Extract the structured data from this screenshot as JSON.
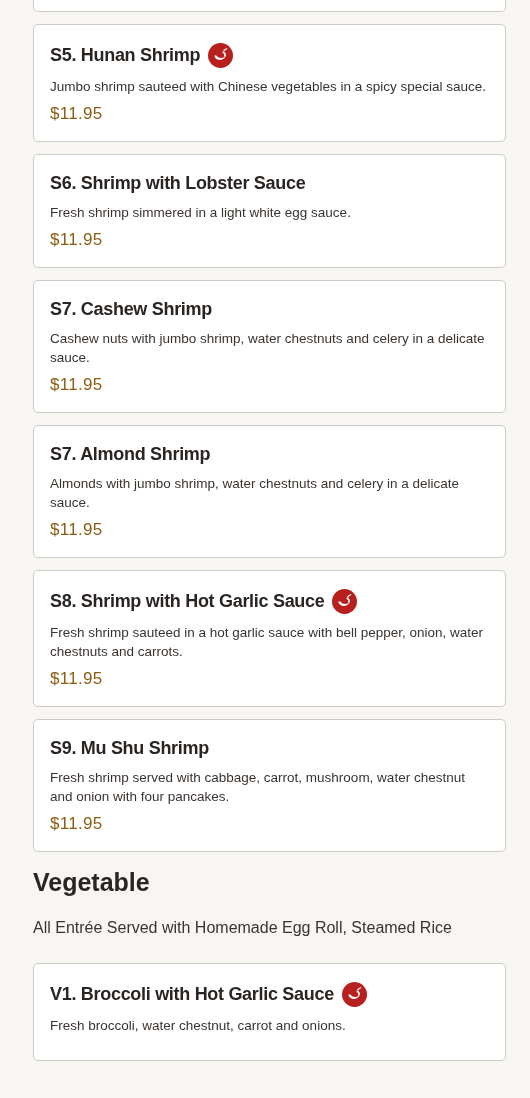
{
  "sections": [
    {
      "items": [
        {
          "name": "S5. Hunan Shrimp",
          "spicy": true,
          "description": "Jumbo shrimp sauteed with Chinese vegetables in a spicy special sauce.",
          "price": "$11.95"
        },
        {
          "name": "S6. Shrimp with Lobster Sauce",
          "spicy": false,
          "description": "Fresh shrimp simmered in a light white egg sauce.",
          "price": "$11.95"
        },
        {
          "name": "S7. Cashew Shrimp",
          "spicy": false,
          "description": "Cashew nuts with jumbo shrimp, water chestnuts and celery in a delicate sauce.",
          "price": "$11.95"
        },
        {
          "name": "S7. Almond Shrimp",
          "spicy": false,
          "description": "Almonds with jumbo shrimp, water chestnuts and celery in a delicate sauce.",
          "price": "$11.95"
        },
        {
          "name": "S8. Shrimp with Hot Garlic Sauce",
          "spicy": true,
          "description": "Fresh shrimp sauteed in a hot garlic sauce with bell pepper, onion, water chestnuts and carrots.",
          "price": "$11.95"
        },
        {
          "name": "S9. Mu Shu Shrimp",
          "spicy": false,
          "description": "Fresh shrimp served with cabbage, carrot, mushroom, water chestnut and onion with four pancakes.",
          "price": "$11.95"
        }
      ]
    },
    {
      "title": "Vegetable",
      "subtitle": "All Entrée Served with Homemade Egg Roll, Steamed Rice",
      "items": [
        {
          "name": "V1. Broccoli with Hot Garlic Sauce",
          "spicy": true,
          "description": "Fresh broccoli, water chestnut, carrot and onions."
        }
      ]
    }
  ]
}
